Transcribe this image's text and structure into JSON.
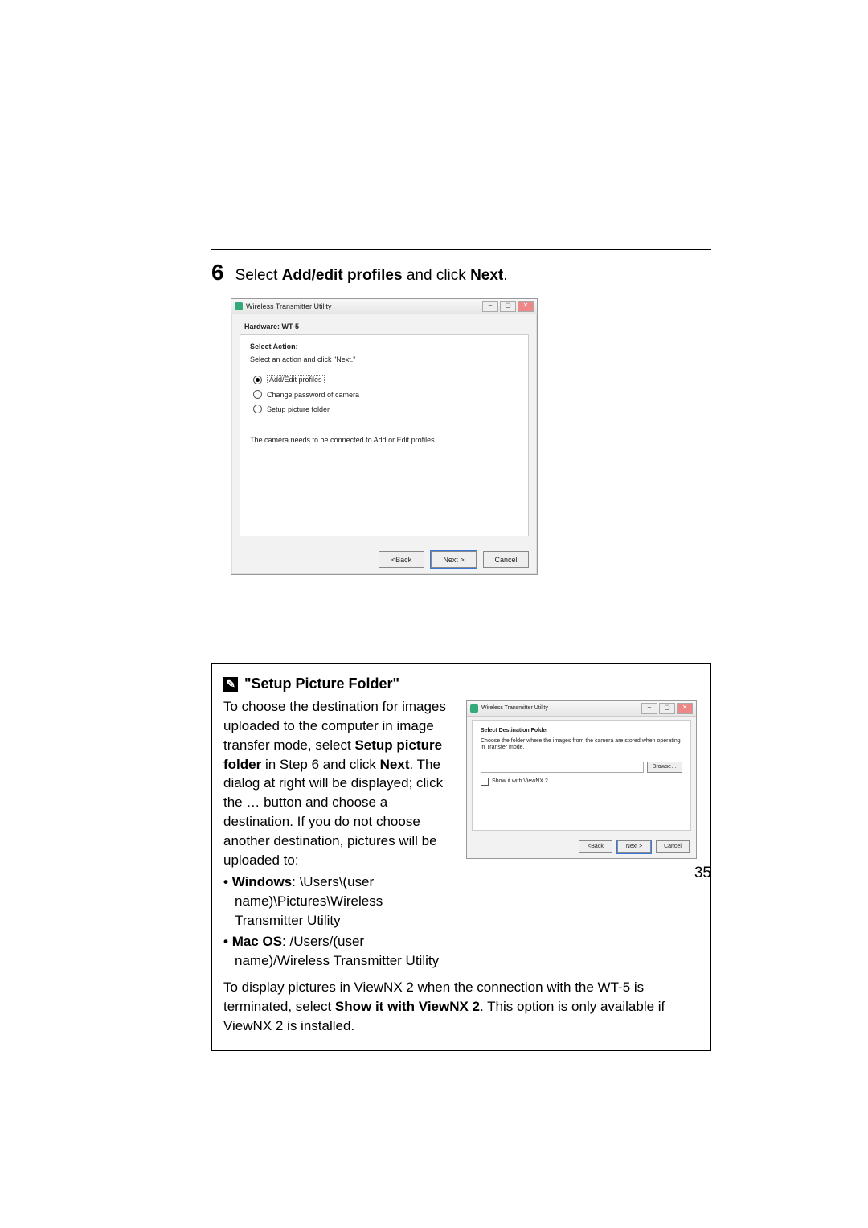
{
  "step": {
    "number": "6",
    "pre": "Select ",
    "bold1": "Add/edit profiles",
    "mid": " and click ",
    "bold2": "Next",
    "post": "."
  },
  "dialog1": {
    "title": "Wireless Transmitter Utility",
    "hardware_label": "Hardware:",
    "hardware_value": "WT-5",
    "heading": "Select Action:",
    "sub": "Select an action and click \"Next.\"",
    "radios": [
      {
        "label": "Add/Edit profiles",
        "selected": true
      },
      {
        "label": "Change password of camera",
        "selected": false
      },
      {
        "label": "Setup picture folder",
        "selected": false
      }
    ],
    "note": "The camera needs to be connected to Add or Edit profiles.",
    "buttons": {
      "back": "<Back",
      "next": "Next >",
      "cancel": "Cancel"
    }
  },
  "infobox": {
    "title": "\"Setup Picture Folder\"",
    "para1_pre": "To choose the destination for images uploaded to the computer in image transfer mode, select ",
    "para1_b1": "Setup picture folder",
    "para1_mid": " in Step 6 and click ",
    "para1_b2": "Next",
    "para1_post": ". The dialog at right will be displayed; click the … button and choose a destination. If you do not choose another destination, pictures will be uploaded to:",
    "defaults": {
      "win_label": "Windows",
      "win_path": ": \\Users\\(user name)\\Pictures\\Wireless Transmitter Utility",
      "mac_label": "Mac OS",
      "mac_path": ": /Users/(user name)/Wireless Transmitter Utility"
    },
    "para2_pre": "To display pictures in ViewNX 2 when the connection with the WT-5 is terminated, select ",
    "para2_b": "Show it with ViewNX 2",
    "para2_post": ". This option is only available if ViewNX 2 is installed."
  },
  "dialog2": {
    "title": "Wireless Transmitter Utility",
    "heading": "Select Destination Folder",
    "sub": "Choose the folder where the images from the camera are stored when operating in Transfer mode.",
    "browse": "Browse…",
    "checkbox": "Show it with ViewNX 2",
    "buttons": {
      "back": "<Back",
      "next": "Next >",
      "cancel": "Cancel"
    }
  },
  "page_number": "35"
}
